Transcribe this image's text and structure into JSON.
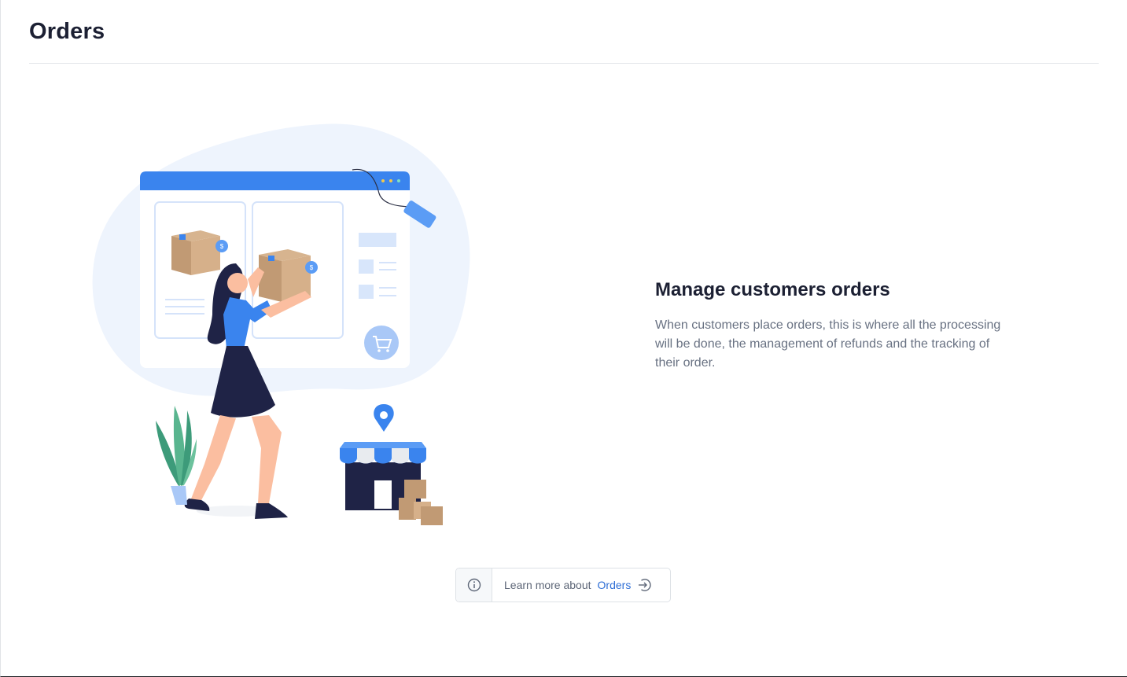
{
  "page": {
    "title": "Orders"
  },
  "empty_state": {
    "title": "Manage customers orders",
    "description": "When customers place orders, this is where all the processing will be done, the management of refunds and the tracking of their order.",
    "illustration": "woman-carrying-box-store-illustration"
  },
  "learn_more": {
    "prefix": "Learn more about",
    "link_label": "Orders",
    "info_icon": "info-circle-icon",
    "arrow_icon": "arrow-circle-right-icon"
  },
  "colors": {
    "accent": "#3a84ee",
    "title": "#1c2033",
    "muted_text": "#687182",
    "link": "#2f6fd6"
  }
}
